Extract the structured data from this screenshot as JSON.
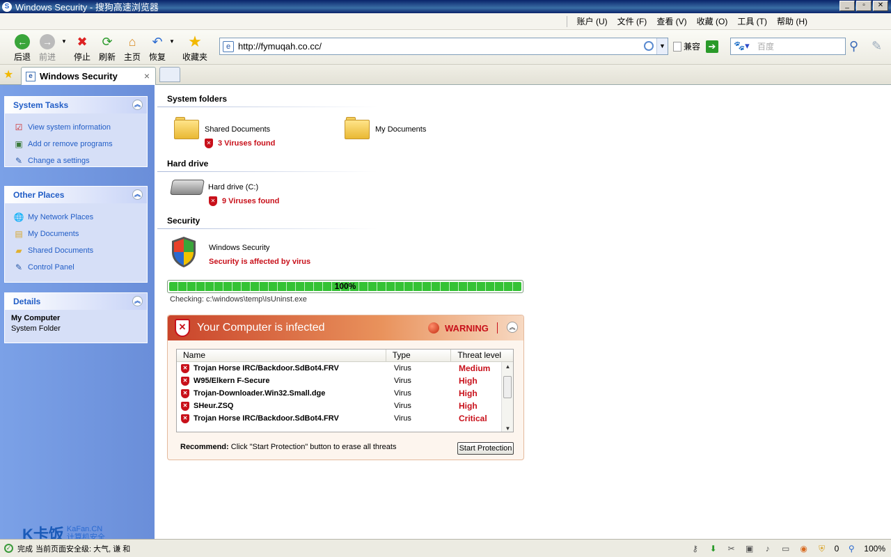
{
  "window": {
    "title": "Windows Security - 搜狗高速浏览器",
    "minimize": "_",
    "restore": "▫",
    "close": "✕"
  },
  "menu": [
    "账户 (U)",
    "文件 (F)",
    "查看 (V)",
    "收藏 (O)",
    "工具 (T)",
    "帮助 (H)"
  ],
  "toolbar": {
    "back": "后退",
    "forward": "前进",
    "stop": "停止",
    "refresh": "刷新",
    "home": "主页",
    "restore": "恢复",
    "favorites": "收藏夹",
    "url": "http://fymuqah.co.cc/",
    "compat": "兼容",
    "search_placeholder": "百度"
  },
  "tab": {
    "title": "Windows Security",
    "close": "×"
  },
  "sidebar": {
    "system_tasks": {
      "title": "System Tasks",
      "items": [
        "View system information",
        "Add or remove programs",
        "Change a settings"
      ]
    },
    "other_places": {
      "title": "Other Places",
      "items": [
        "My Network Places",
        "My Documents",
        "Shared Documents",
        "Control Panel"
      ]
    },
    "details": {
      "title": "Details",
      "name": "My Computer",
      "type": "System Folder"
    }
  },
  "main": {
    "system_folders": "System folders",
    "shared_documents": "Shared Documents",
    "shared_viruses": "3 Viruses found",
    "my_documents": "My Documents",
    "hard_drive_section": "Hard drive",
    "hard_drive_label": "Hard drive (C:)",
    "hard_drive_viruses": "9 Viruses found",
    "security_section": "Security",
    "windows_security": "Windows Security",
    "security_status": "Security is affected by virus",
    "progress_fraction": 1.0,
    "progress_text": "100%",
    "checking": "Checking: c:\\windows\\temp\\IsUninst.exe"
  },
  "warning": {
    "title": "Your Computer is infected",
    "label": "WARNING",
    "columns": [
      "Name",
      "Type",
      "Threat level"
    ],
    "rows": [
      {
        "name": "Trojan Horse IRC/Backdoor.SdBot4.FRV",
        "type": "Virus",
        "level": "Medium"
      },
      {
        "name": "W95/Elkern F-Secure",
        "type": "Virus",
        "level": "High"
      },
      {
        "name": "Trojan-Downloader.Win32.Small.dge",
        "type": "Virus",
        "level": "High"
      },
      {
        "name": "SHeur.ZSQ",
        "type": "Virus",
        "level": "High"
      },
      {
        "name": "Trojan Horse IRC/Backdoor.SdBot4.FRV",
        "type": "Virus",
        "level": "Critical"
      }
    ],
    "recommend_bold": "Recommend:",
    "recommend_text": " Click \"Start Protection\" button to erase all threats",
    "start_button": "Start Protection"
  },
  "statusbar": {
    "text": "完成",
    "overlay": "当前页面安全级: 大气, 谦 和",
    "count": "0",
    "zoom": "100%"
  },
  "watermark": {
    "logo": "K卡饭",
    "site": "KaFan.CN",
    "subtitle": "计算机安全"
  }
}
